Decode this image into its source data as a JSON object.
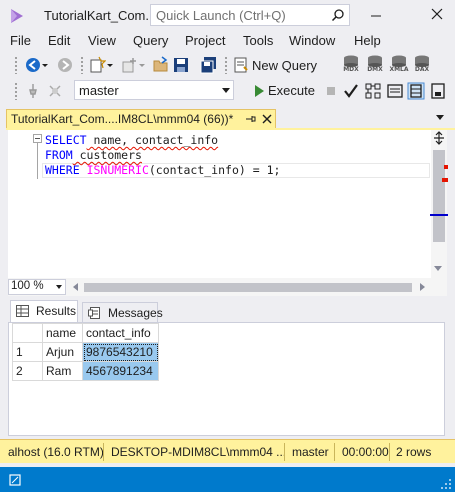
{
  "app": {
    "title": "TutorialKart_Com...",
    "quick_launch_placeholder": "Quick Launch (Ctrl+Q)"
  },
  "menu": [
    "File",
    "Edit",
    "View",
    "Query",
    "Project",
    "Tools",
    "Window",
    "Help"
  ],
  "toolbar": {
    "new_query_label": "New Query",
    "query_type_buttons": [
      "MDX",
      "DMX",
      "XMLA",
      "DAX"
    ],
    "database": "master",
    "execute_label": "Execute"
  },
  "document_tab": {
    "label": "TutorialKart_Com....IM8CL\\mmm04 (66))*"
  },
  "editor": {
    "lines": [
      {
        "keyword": "SELECT",
        "rest": " name, contact_info"
      },
      {
        "keyword": "FROM",
        "rest": " customers"
      },
      {
        "keyword": "WHERE",
        "func": "ISNUMERIC",
        "rest": "(contact_info) = 1;"
      }
    ],
    "zoom": "100 %"
  },
  "results": {
    "tabs": [
      "Results",
      "Messages"
    ],
    "columns": [
      "name",
      "contact_info"
    ],
    "rows": [
      {
        "num": "1",
        "name": "Arjun",
        "contact_info": "9876543210"
      },
      {
        "num": "2",
        "name": "Ram",
        "contact_info": "4567891234"
      }
    ]
  },
  "status": {
    "server": "alhost (16.0 RTM)",
    "connection": "DESKTOP-MDIM8CL\\mmm04 ...",
    "database": "master",
    "elapsed": "00:00:00",
    "rows": "2 rows"
  },
  "colors": {
    "accent": "#007acc",
    "tab_yellow": "#fff29d",
    "keyword_blue": "#0000ff",
    "function_magenta": "#ff00ff",
    "selection_blue": "#99c9ef"
  }
}
